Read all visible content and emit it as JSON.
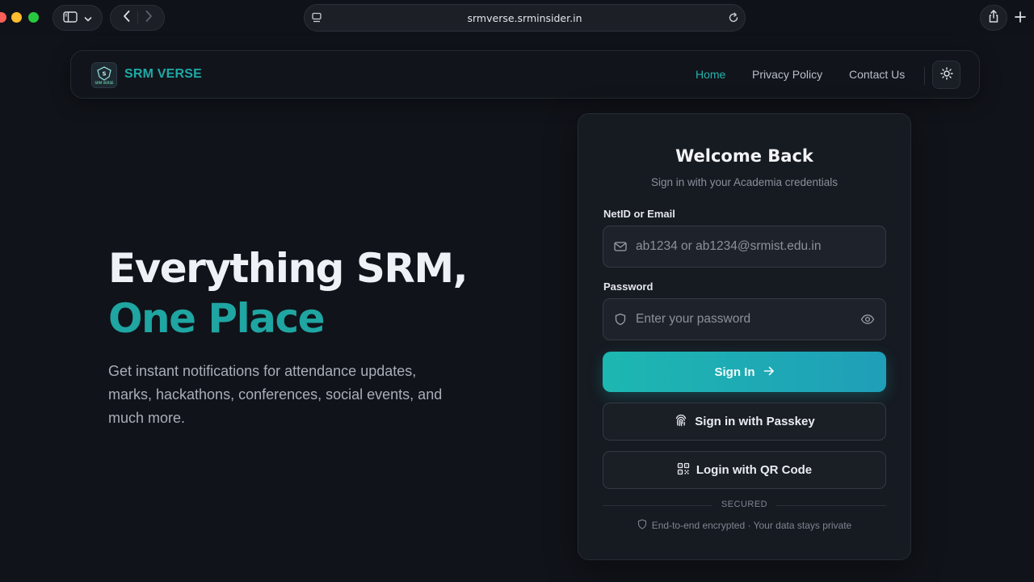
{
  "browser": {
    "url": "srmverse.srminsider.in"
  },
  "navbar": {
    "brand": "SRM VERSE",
    "logo_text": "SRM VERSE",
    "links": [
      {
        "label": "Home",
        "active": true
      },
      {
        "label": "Privacy Policy",
        "active": false
      },
      {
        "label": "Contact Us",
        "active": false
      }
    ],
    "accent_color": "#1fa9a6"
  },
  "hero": {
    "line1": "Everything SRM,",
    "line2": "One Place",
    "description": "Get instant notifications for attendance updates, marks, hackathons, conferences, social events, and much more."
  },
  "login": {
    "title": "Welcome Back",
    "subtitle": "Sign in with your Academia credentials",
    "netid_label": "NetID or Email",
    "netid_placeholder": "ab1234 or ab1234@srmist.edu.in",
    "netid_value": "",
    "password_label": "Password",
    "password_placeholder": "Enter your password",
    "password_value": "",
    "sign_in_label": "Sign In",
    "passkey_label": "Sign in with Passkey",
    "qr_label": "Login with QR Code",
    "secured_label": "SECURED",
    "encryption_note": "End-to-end encrypted · Your data stays private"
  },
  "icons": {
    "sidebar": "sidebar-icon",
    "back": "chevron-left-icon",
    "forward": "chevron-right-icon",
    "reload": "reload-icon",
    "share": "share-icon",
    "new_tab": "plus-icon",
    "theme": "sun-icon",
    "email": "mail-icon",
    "password": "shield-icon",
    "show_password": "eye-icon",
    "arrow": "arrow-right-icon",
    "passkey": "fingerprint-icon",
    "qr": "qr-code-icon"
  }
}
